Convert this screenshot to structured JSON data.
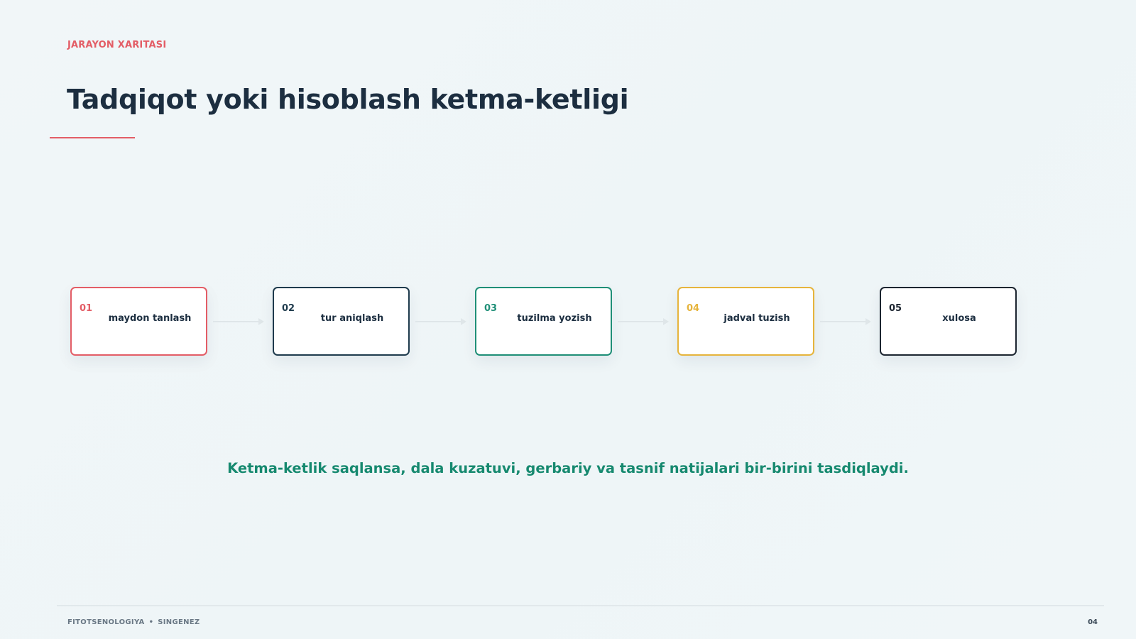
{
  "header": {
    "eyebrow": "JARAYON XARITASI",
    "title": "Tadqiqot yoki hisoblash ketma-ketligi"
  },
  "steps": [
    {
      "number": "01",
      "label": "maydon tanlash",
      "color": "#e35d66"
    },
    {
      "number": "02",
      "label": "tur aniqlash",
      "color": "#1f3b4d"
    },
    {
      "number": "03",
      "label": "tuzilma yozish",
      "color": "#1f8f77"
    },
    {
      "number": "04",
      "label": "jadval tuzish",
      "color": "#e6b43c"
    },
    {
      "number": "05",
      "label": "xulosa",
      "color": "#1c2530"
    }
  ],
  "takeaway": "Ketma-ketlik saqlansa, dala kuzatuvi, gerbariy va tasnif natijalari bir-birini tasdiqlaydi.",
  "footer": {
    "left_primary": "FITOTSENOLOGIYA",
    "separator": "•",
    "left_secondary": "SINGENEZ",
    "page_number": "04"
  },
  "colors": {
    "accent": "#e35d66",
    "title": "#1c2e40",
    "takeaway": "#16896f",
    "background": "#eff5f7"
  }
}
